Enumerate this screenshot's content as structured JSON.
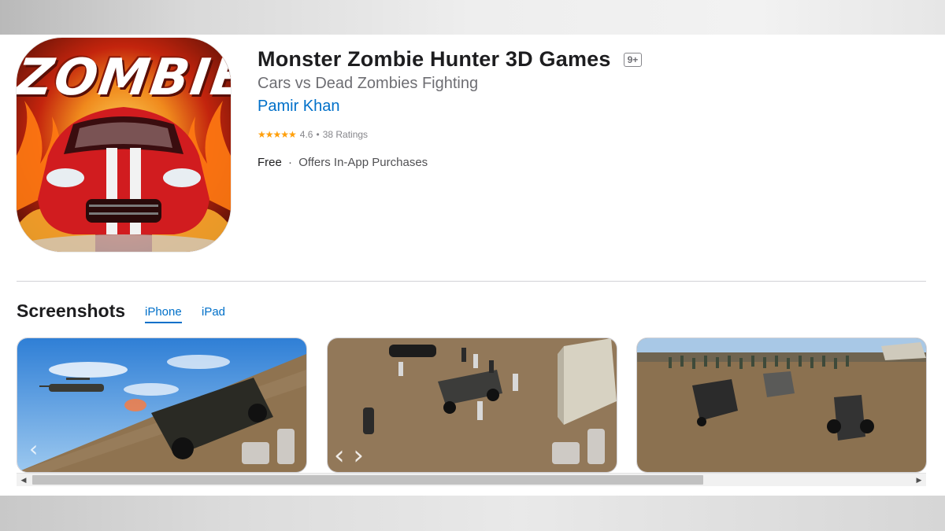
{
  "app": {
    "title": "Monster Zombie Hunter 3D Games",
    "age_rating": "9+",
    "subtitle": "Cars vs Dead Zombies Fighting",
    "developer": "Pamir Khan",
    "rating_stars": "★★★★★",
    "rating_value": "4.6",
    "rating_separator": "•",
    "rating_count": "38 Ratings",
    "price": "Free",
    "price_separator": "·",
    "iap": "Offers In-App Purchases",
    "icon_text": "ZOMBIE"
  },
  "screenshots": {
    "title": "Screenshots",
    "tabs": [
      {
        "label": "iPhone",
        "active": true
      },
      {
        "label": "iPad",
        "active": false
      }
    ]
  },
  "scrollbar": {
    "left_arrow": "◀",
    "right_arrow": "▶"
  },
  "colors": {
    "link": "#0070c9",
    "star": "#ff9f0a"
  }
}
